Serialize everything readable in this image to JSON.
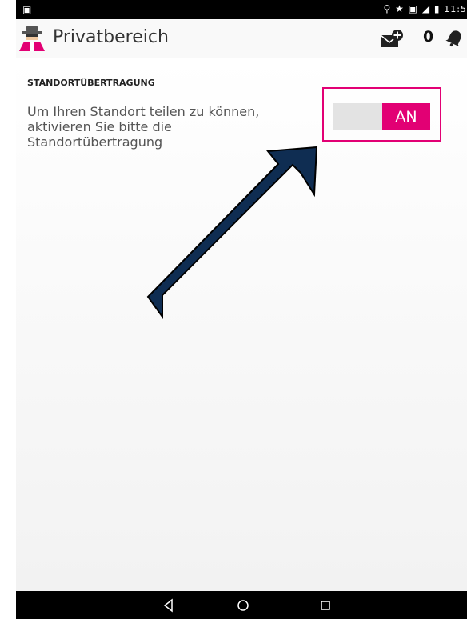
{
  "status_bar": {
    "left_icon": "notification-image-icon",
    "right_icons": [
      "location-icon",
      "star-icon",
      "vibrate-icon",
      "signal-icon",
      "battery-icon"
    ],
    "right_glyphs": "⚲ ★ ▣ ◢ ▮",
    "time": "11:5"
  },
  "app_bar": {
    "menu_icon": "hamburger-menu-icon",
    "logo_icon": "private-mode-agent-icon",
    "title": "Privatbereich",
    "mail_icon": "mail-add-icon",
    "count": "0",
    "bell_icon": "bell-icon"
  },
  "settings": {
    "heading": "STANDORTÜBERTRAGUNG",
    "description": "Um Ihren Standort teilen zu können, aktivieren Sie bitte die Standortübertragung",
    "toggle_label": "AN",
    "toggle_on": true
  },
  "colors": {
    "accent": "#e20074",
    "arrow_fill": "#0f2d52",
    "status_bar": "#000000",
    "nav_bar": "#000000"
  },
  "nav_bar": {
    "back_icon": "back-triangle-icon",
    "home_icon": "home-circle-icon",
    "recents_icon": "recents-square-icon"
  }
}
